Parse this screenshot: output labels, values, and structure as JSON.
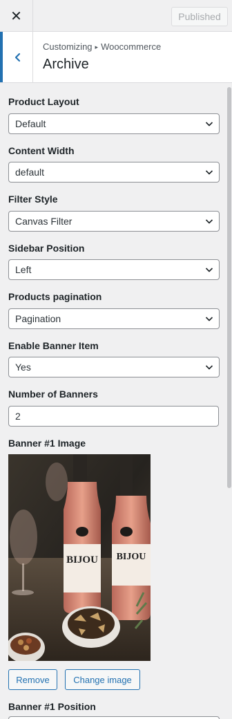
{
  "topbar": {
    "close_icon": "close-icon",
    "publish_label": "Published"
  },
  "header": {
    "breadcrumb_root": "Customizing",
    "breadcrumb_separator": "▸",
    "breadcrumb_section": "Woocommerce",
    "title": "Archive",
    "back_icon": "chevron-left-icon",
    "accent_color": "#2271b1"
  },
  "controls": [
    {
      "label": "Product Layout",
      "value": "Default"
    },
    {
      "label": "Content Width",
      "value": "default"
    },
    {
      "label": "Filter Style",
      "value": "Canvas Filter"
    },
    {
      "label": "Sidebar Position",
      "value": "Left"
    },
    {
      "label": "Products pagination",
      "value": "Pagination"
    },
    {
      "label": "Enable Banner Item",
      "value": "Yes"
    }
  ],
  "banner_count": {
    "label": "Number of Banners",
    "value": "2"
  },
  "banner_image": {
    "label": "Banner #1 Image",
    "remove_label": "Remove",
    "change_label": "Change image",
    "bottle_text": "BIJOU"
  },
  "banner_position": {
    "label": "Banner #1 Position"
  }
}
